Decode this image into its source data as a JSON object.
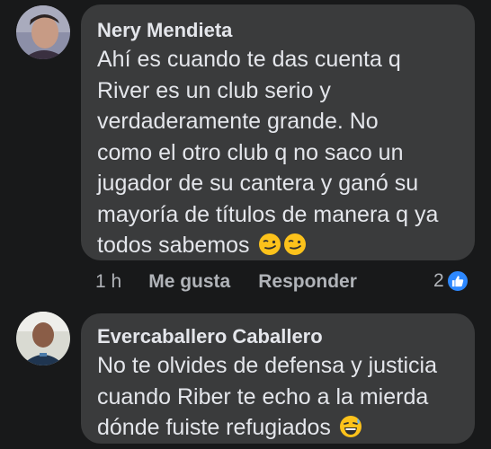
{
  "comments": [
    {
      "author": "Nery Mendieta",
      "lines": [
        "Ahí es cuando te das cuenta q",
        "River es un club serio y",
        "verdaderamente grande. No",
        "como el otro club q no saco un",
        "jugador de su cantera y ganó su",
        "mayoría de títulos de manera q ya",
        "todos sabemos"
      ],
      "emoji": [
        "smirk-face-icon",
        "smirk-face-icon"
      ],
      "time": "1 h",
      "like_label": "Me gusta",
      "reply_label": "Responder",
      "reaction_count": "2"
    },
    {
      "author": "Evercaballero Caballero",
      "lines": [
        "No te olvides de defensa y justicia",
        "cuando Riber te echo a la mierda",
        "dónde fuiste refugiados"
      ],
      "emoji": [
        "grinning-sweat-face-icon"
      ]
    }
  ],
  "colors": {
    "background": "#18191a",
    "bubble": "#3a3b3c",
    "text": "#e4e6eb",
    "secondary_text": "#b0b3b8",
    "like_blue": "#2d88ff"
  }
}
